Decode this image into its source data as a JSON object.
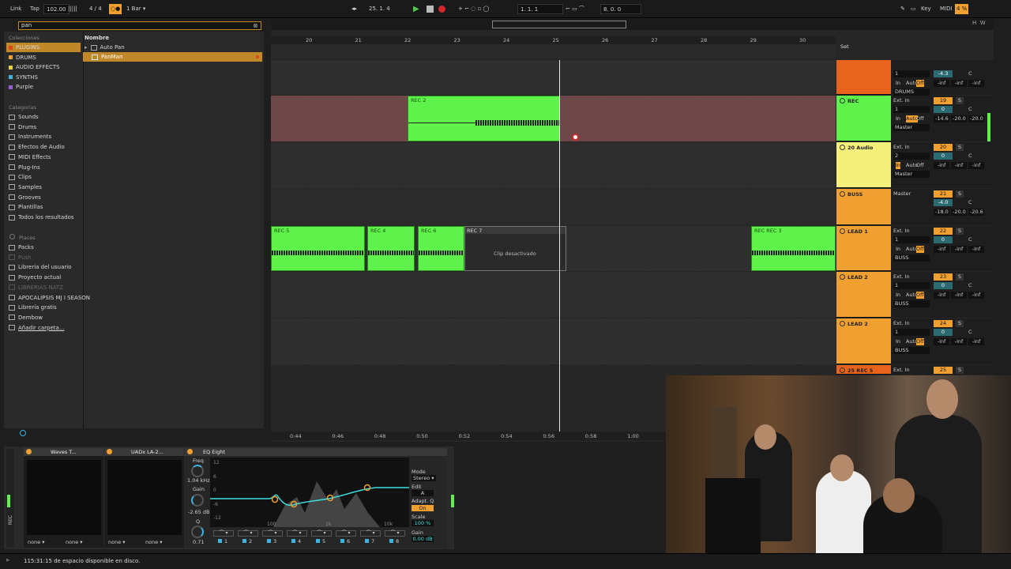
{
  "topbar": {
    "link": "Link",
    "tap": "Tap",
    "tempo": "102.00",
    "signature": "4 / 4",
    "quantize": "1 Bar",
    "position": "25. 1. 4",
    "loop_start": "1. 1. 1",
    "loop_length": "8. 0. 0",
    "key": "Key",
    "midi": "MIDI",
    "cpu": "4 %"
  },
  "browser": {
    "search_value": "pan",
    "collections_header": "Colecciones",
    "collections": [
      {
        "label": "PLUGINS",
        "color": "#e0421c"
      },
      {
        "label": "DRUMS",
        "color": "#f0a030"
      },
      {
        "label": "AUDIO EFFECTS",
        "color": "#e8d040"
      },
      {
        "label": "SYNTHS",
        "color": "#3cb4e0"
      },
      {
        "label": "Purple",
        "color": "#9a5ad8"
      }
    ],
    "categories_header": "Categorías",
    "categories": [
      "Sounds",
      "Drums",
      "Instruments",
      "Efectos de Audio",
      "MIDI Effects",
      "Plug-Ins",
      "Clips",
      "Samples",
      "Grooves",
      "Plantillas",
      "Todos los resultados"
    ],
    "places_header": "Places",
    "places": [
      "Packs",
      "Push",
      "Librería del usuario",
      "Proyecto actual",
      "LIBRERIAS NATZ",
      "APOCALIPSIS MJ I SEASON",
      "Librería gratis",
      "Dembow",
      "Añadir carpeta..."
    ],
    "name_header": "Nombre",
    "results": [
      "Auto Pan",
      "PanMan"
    ]
  },
  "arrangement": {
    "ruler_bars": [
      "20",
      "21",
      "22",
      "23",
      "24",
      "25",
      "26",
      "27",
      "28",
      "29",
      "30"
    ],
    "time_ticks": [
      "0:44",
      "0:46",
      "0:48",
      "0:50",
      "0:52",
      "0:54",
      "0:56",
      "0:58",
      "1:00"
    ],
    "set_label": "Set",
    "clips": [
      {
        "name": "REC 2"
      },
      {
        "name": "REC 5"
      },
      {
        "name": "REC 4"
      },
      {
        "name": "REC 6"
      },
      {
        "name": "REC 7",
        "disabled_label": "Clip desactivado"
      },
      {
        "name": "REC REC 3"
      }
    ]
  },
  "tracks": [
    {
      "name": "",
      "color": "#e8641c",
      "input": "",
      "channel": "1",
      "monitor": [
        "In",
        "Auto",
        "Off"
      ],
      "output": "DRUMS",
      "number": "",
      "vol": "-4.3",
      "pan": "C",
      "sends": [
        "-inf",
        "-inf",
        "-inf"
      ]
    },
    {
      "name": "REC",
      "color": "#5ef24a",
      "input": "Ext. In",
      "channel": "1",
      "monitor": [
        "In",
        "Auto",
        "Off"
      ],
      "output": "Master",
      "number": "19",
      "vol": "0",
      "pan": "C",
      "sends": [
        "-14.6",
        "-20.0",
        "-20.0"
      ]
    },
    {
      "name": "20 Audio",
      "color": "#f5f07a",
      "input": "Ext. In",
      "channel": "2",
      "monitor": [
        "In",
        "Auto",
        "Off"
      ],
      "output": "Master",
      "number": "20",
      "vol": "0",
      "pan": "C",
      "sends": [
        "-inf",
        "-inf",
        "-inf"
      ]
    },
    {
      "name": "BUSS",
      "color": "#f0a030",
      "input": "Master",
      "channel": "",
      "monitor": [],
      "output": "",
      "number": "21",
      "vol": "-4.0",
      "pan": "C",
      "sends": [
        "-18.0",
        "-20.0",
        "-20.6"
      ]
    },
    {
      "name": "LEAD 1",
      "color": "#f0a030",
      "input": "Ext. In",
      "channel": "1",
      "monitor": [
        "In",
        "Auto",
        "Off"
      ],
      "output": "BUSS",
      "number": "22",
      "vol": "0",
      "pan": "C",
      "sends": [
        "-inf",
        "-inf",
        "-inf"
      ]
    },
    {
      "name": "LEAD 2",
      "color": "#f0a030",
      "input": "Ext. In",
      "channel": "1",
      "monitor": [
        "In",
        "Auto",
        "Off"
      ],
      "output": "BUSS",
      "number": "23",
      "vol": "0",
      "pan": "C",
      "sends": [
        "-inf",
        "-inf",
        "-inf"
      ]
    },
    {
      "name": "LEAD 2",
      "color": "#f0a030",
      "input": "Ext. In",
      "channel": "1",
      "monitor": [
        "In",
        "Auto",
        "Off"
      ],
      "output": "BUSS",
      "number": "24",
      "vol": "0",
      "pan": "C",
      "sends": [
        "-inf",
        "-inf",
        "-inf"
      ]
    },
    {
      "name": "25 REC 5",
      "color": "#e8641c",
      "input": "Ext. In",
      "channel": "",
      "monitor": [],
      "output": "",
      "number": "25",
      "vol": "",
      "pan": "",
      "sends": []
    }
  ],
  "devices": {
    "waves": "Waves T...",
    "uadx": "UADx LA-2...",
    "eq": "EQ Eight",
    "eq_freq_label": "Freq",
    "eq_freq": "1.04 kHz",
    "eq_gain_label": "Gain",
    "eq_gain": "-2.65 dB",
    "eq_q_label": "Q",
    "eq_q": "0.71",
    "mode_label": "Mode",
    "mode": "Stereo",
    "edit_label": "Edit",
    "edit_value": "A",
    "adaptq_label": "Adapt. Q",
    "adaptq": "On",
    "scale_label": "Scale",
    "scale": "100 %",
    "gain_label": "Gain",
    "gain": "0.00 dB",
    "db_ticks": [
      "12",
      "6",
      "0",
      "-6",
      "-12"
    ],
    "freq_ticks": [
      "100",
      "1k",
      "10k"
    ],
    "bands": [
      "1",
      "2",
      "3",
      "4",
      "5",
      "6",
      "7",
      "8"
    ],
    "none": "none",
    "rec_label": "REC"
  },
  "status": {
    "text": "115:31:15 de espacio disponible en disco."
  }
}
